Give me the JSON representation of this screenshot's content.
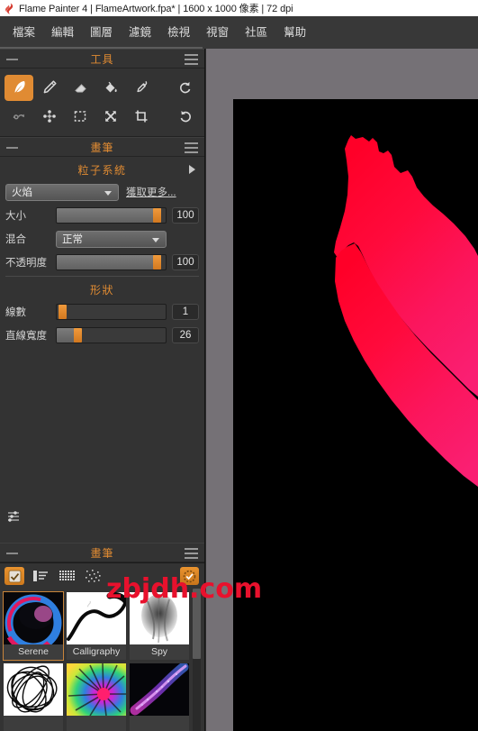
{
  "titlebar": {
    "text": "Flame Painter 4 | FlameArtwork.fpa* | 1600 x 1000 像素 | 72 dpi",
    "logo_icon": "flame-logo-icon"
  },
  "menubar": {
    "items": [
      {
        "label": "檔案"
      },
      {
        "label": "編輯"
      },
      {
        "label": "圖層"
      },
      {
        "label": "濾鏡"
      },
      {
        "label": "檢視"
      },
      {
        "label": "視窗"
      },
      {
        "label": "社區"
      },
      {
        "label": "幫助"
      }
    ]
  },
  "tools_panel": {
    "title": "工具",
    "row1": [
      {
        "icon": "feather-brush-icon",
        "selected": true
      },
      {
        "icon": "pencil-icon",
        "selected": false
      },
      {
        "icon": "eraser-icon",
        "selected": false
      },
      {
        "icon": "paint-bucket-icon",
        "selected": false
      },
      {
        "icon": "eyedropper-icon",
        "selected": false
      },
      {
        "icon": "undo-rotate-icon",
        "selected": false
      }
    ],
    "row2": [
      {
        "icon": "redo-curve-icon",
        "selected": false
      },
      {
        "icon": "node-edit-icon",
        "selected": false
      },
      {
        "icon": "marquee-select-icon",
        "selected": false
      },
      {
        "icon": "move-transform-icon",
        "selected": false
      },
      {
        "icon": "crop-icon",
        "selected": false
      },
      {
        "icon": "redo-rotate-icon",
        "selected": false
      }
    ]
  },
  "brush_panel": {
    "title": "畫筆",
    "section_particle": {
      "label": "粒子系統",
      "expand_icon": "triangle-right-icon"
    },
    "preset": {
      "value": "火焰",
      "caret_icon": "chevron-down-icon"
    },
    "get_more_label": "獲取更多...",
    "size": {
      "label": "大小",
      "value": "100",
      "percent": 96
    },
    "blend": {
      "label": "混合",
      "value": "正常",
      "caret_icon": "chevron-down-icon"
    },
    "opacity": {
      "label": "不透明度",
      "value": "100",
      "percent": 96
    },
    "section_shape": {
      "label": "形狀"
    },
    "lines": {
      "label": "線數",
      "value": "1",
      "percent": 3
    },
    "line_width": {
      "label": "直線寬度",
      "value": "26",
      "percent": 19
    },
    "settings_icon": "sliders-icon"
  },
  "library_panel": {
    "title": "畫筆",
    "view_buttons": [
      {
        "icon": "checkbox-checked-icon",
        "active": true
      },
      {
        "icon": "list-view-icon",
        "active": false
      },
      {
        "icon": "grid-view-icon",
        "active": false
      },
      {
        "icon": "scatter-dots-icon",
        "active": false
      }
    ],
    "refresh_button": {
      "icon": "sync-refresh-icon"
    },
    "brushes": [
      {
        "name": "Serene",
        "selected": true,
        "thumb": "serene-thumb"
      },
      {
        "name": "Calligraphy",
        "selected": false,
        "thumb": "calligraphy-thumb"
      },
      {
        "name": "Spy",
        "selected": false,
        "thumb": "spy-thumb"
      },
      {
        "name": "",
        "selected": false,
        "thumb": "scribble-thumb"
      },
      {
        "name": "",
        "selected": false,
        "thumb": "rainbow-spiral-thumb"
      },
      {
        "name": "",
        "selected": false,
        "thumb": "purple-particles-thumb"
      }
    ]
  },
  "canvas": {
    "background_color": "#000000",
    "artwork_name": "flame-stroke",
    "gradient_from": "#ff0033",
    "gradient_to": "#ff1f6e"
  },
  "watermark": {
    "text": "zbjdh.com",
    "color": "#e8112d"
  }
}
